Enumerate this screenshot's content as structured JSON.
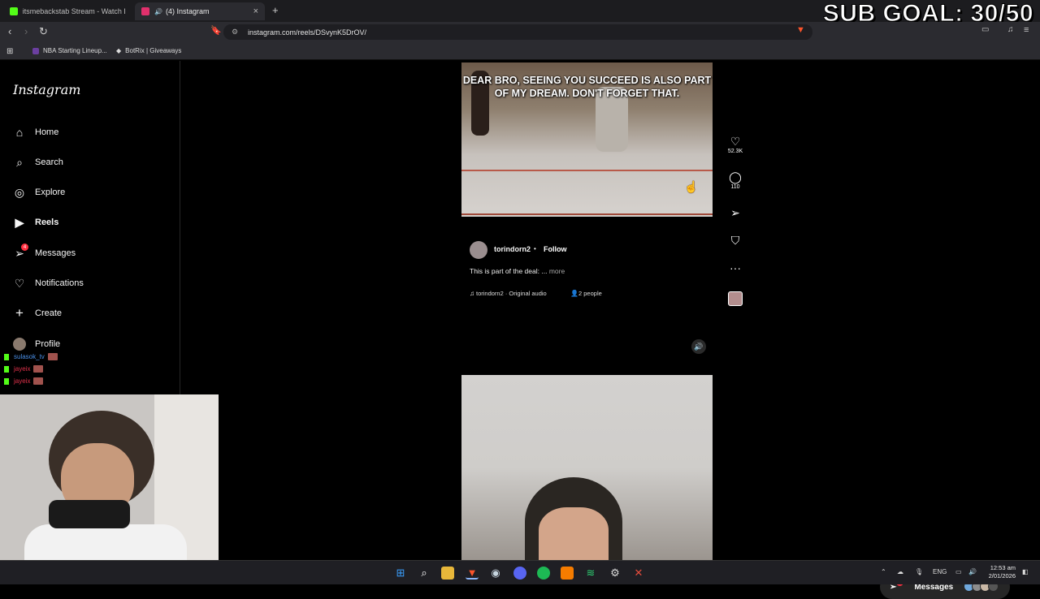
{
  "overlay": {
    "sub_goal": "SUB GOAL: 30/50"
  },
  "browser": {
    "tabs": [
      {
        "label": "itsmebackstab Stream - Watch Live o",
        "favicon_color": "#53fc18"
      },
      {
        "label": "(4) Instagram",
        "favicon_color": "#e1306c"
      }
    ],
    "url": "instagram.com/reels/DSvynK5DrOV/",
    "bookmarks": [
      {
        "label": "NBA Starting Lineup...",
        "color": "#6b3fa0"
      },
      {
        "label": "BotRix | Giveaways",
        "color": "#ffffff"
      }
    ]
  },
  "sidebar": {
    "logo": "Instagram",
    "items": [
      {
        "label": "Home",
        "icon": "home-icon"
      },
      {
        "label": "Search",
        "icon": "search-icon"
      },
      {
        "label": "Explore",
        "icon": "compass-icon"
      },
      {
        "label": "Reels",
        "icon": "reels-icon"
      },
      {
        "label": "Messages",
        "icon": "send-icon",
        "badge": "4"
      },
      {
        "label": "Notifications",
        "icon": "heart-icon"
      },
      {
        "label": "Create",
        "icon": "plus-icon"
      },
      {
        "label": "Profile",
        "icon": "avatar-icon"
      }
    ]
  },
  "chat_overlay": [
    {
      "user": "sulasok_tv",
      "color": "#4a8fe7"
    },
    {
      "user": "jayeix",
      "color": "#e0304a"
    },
    {
      "user": "jayeix",
      "color": "#e0304a"
    }
  ],
  "reel": {
    "caption": "DEAR BRO, SEEING YOU SUCCEED IS ALSO PART OF MY DREAM. DON'T FORGET THAT.",
    "author": "torindorn2",
    "separator": "•",
    "follow_label": "Follow",
    "description": "This is part of the deal: ...",
    "more_label": "more",
    "audio": "torindorn2 · Original audio",
    "people": "2 people",
    "likes": "52.3K",
    "comments": "110"
  },
  "messages_pill": {
    "label": "Messages",
    "badge": "4"
  },
  "taskbar": {
    "lang": "ENG",
    "time": "12:53 am",
    "date": "2/01/2026"
  }
}
